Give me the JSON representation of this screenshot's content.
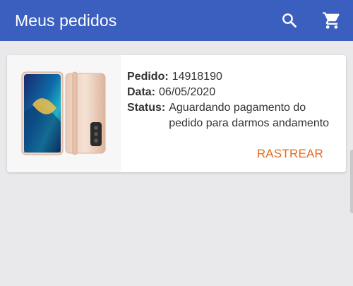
{
  "app_bar": {
    "title": "Meus pedidos",
    "color": "#3a5fbf",
    "actions": [
      {
        "icon": "search-icon"
      },
      {
        "icon": "cart-icon"
      }
    ]
  },
  "order": {
    "product_image": "phone-icon",
    "order_label": "Pedido:",
    "order_number": "14918190",
    "date_label": "Data:",
    "date": "06/05/2020",
    "status_label": "Status:",
    "status": "Aguardando pagamento do pedido para darmos andamento",
    "track_label": "RASTREAR",
    "accent": "#e36b1d"
  }
}
